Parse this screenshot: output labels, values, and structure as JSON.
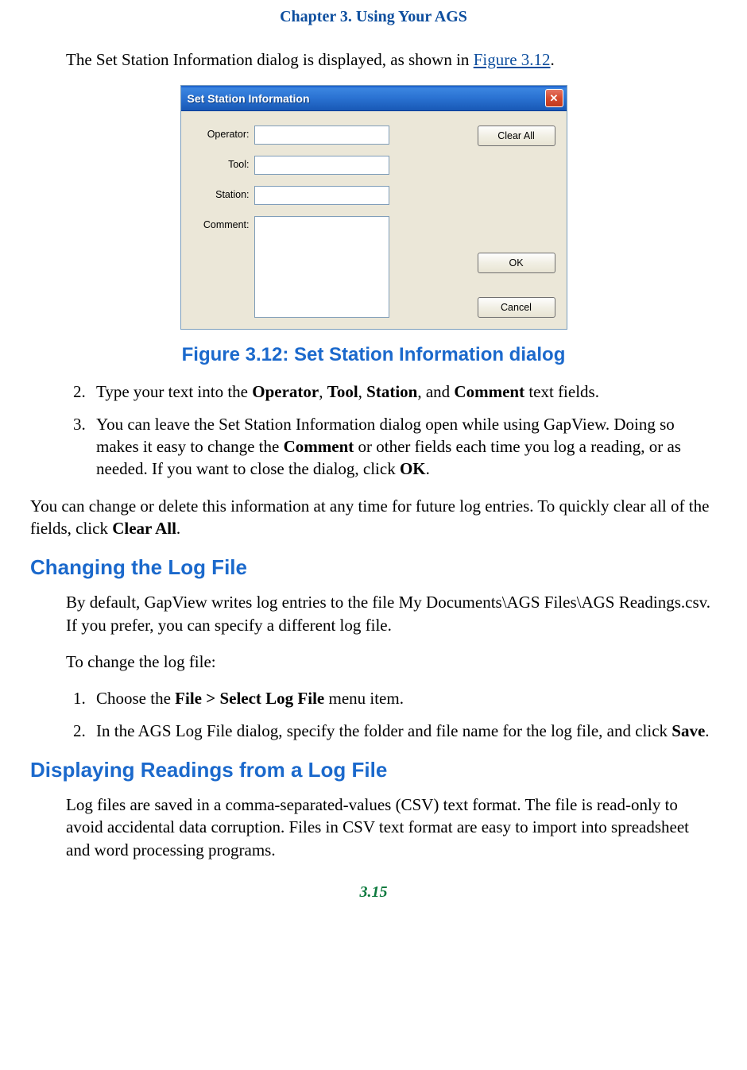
{
  "chapter_header": "Chapter 3. Using Your AGS",
  "intro_text_pre": "The Set Station Information dialog is displayed, as shown in ",
  "intro_link": "Figure 3.12",
  "intro_text_post": ".",
  "dialog": {
    "title": "Set Station Information",
    "close_glyph": "✕",
    "labels": {
      "operator": "Operator:",
      "tool": "Tool:",
      "station": "Station:",
      "comment": "Comment:"
    },
    "buttons": {
      "clear_all": "Clear All",
      "ok": "OK",
      "cancel": "Cancel"
    }
  },
  "figure_caption": "Figure 3.12: Set Station Information dialog",
  "steps_a_start": "2",
  "steps_a": {
    "s2_pre": "Type your text into the ",
    "s2_b1": "Operator",
    "s2_m1": ", ",
    "s2_b2": "Tool",
    "s2_m2": ", ",
    "s2_b3": "Station",
    "s2_m3": ", and ",
    "s2_b4": "Comment",
    "s2_post": " text fields.",
    "s3_pre": "You can leave the Set Station Information dialog open while using GapView. Doing so makes it easy to change the ",
    "s3_b1": "Comment",
    "s3_mid": " or other fields each time you log a reading, or as needed. If you want to close the dialog, click ",
    "s3_b2": "OK",
    "s3_post": "."
  },
  "para_clear_pre": "You can change or delete this information at any time for future log entries. To quickly clear all of the fields, click ",
  "para_clear_b": "Clear All",
  "para_clear_post": ".",
  "sec1_head": "Changing the Log File",
  "sec1_p1": "By default, GapView writes log entries to the file My Documents\\AGS Files\\AGS Readings.csv. If you prefer, you can specify a different log file.",
  "sec1_p2": "To change the log file:",
  "steps_b": {
    "s1_pre": "Choose the ",
    "s1_b": "File > Select Log File",
    "s1_post": " menu item.",
    "s2_pre": "In the AGS Log File dialog, specify the folder and file name for the log file, and click ",
    "s2_b": "Save",
    "s2_post": "."
  },
  "sec2_head": "Displaying Readings from a Log File",
  "sec2_p1": "Log files are saved in a comma-separated-values (CSV) text format. The file is read-only to avoid accidental data corruption. Files in CSV text format are easy to import into spreadsheet and word processing programs.",
  "page_number": "3.15"
}
